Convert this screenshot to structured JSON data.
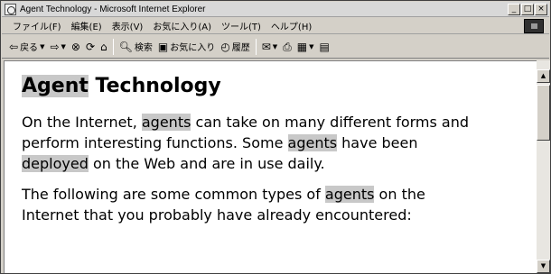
{
  "window": {
    "title": "Agent Technology - Microsoft Internet Explorer",
    "controls": [
      "_",
      "□",
      "×"
    ]
  },
  "menubar": {
    "items": [
      "ファイル(F)",
      "編集(E)",
      "表示(V)",
      "お気に入り(A)",
      "ツール(T)",
      "ヘルプ(H)"
    ]
  },
  "toolbar": {
    "back_label": "戻る",
    "search_label": "検索",
    "favorites_label": "お気に入り",
    "history_label": "履歴"
  },
  "page": {
    "heading_highlight": "Agent",
    "heading_rest": " Technology",
    "para1": {
      "line1_a": "On the Internet, ",
      "line1_hl": "agents",
      "line1_b": " can take on many different forms and",
      "line2_a": "perform interesting functions. Some ",
      "line2_hl": "agents",
      "line2_b": " have been",
      "line3_hl": "deployed",
      "line3_b": " on the Web and are in use daily."
    },
    "para2": {
      "line1_a": "The following are some common types of ",
      "line1_hl": "agents",
      "line1_b": " on the",
      "line2": "Internet that you probably have already encountered:"
    }
  },
  "icons": {
    "back": "back-arrow-icon",
    "forward": "forward-arrow-icon",
    "stop": "stop-icon",
    "refresh": "refresh-icon",
    "home": "home-icon",
    "search": "search-icon",
    "favorites": "favorites-icon",
    "history": "history-icon",
    "mail": "mail-icon",
    "print": "print-icon",
    "edit": "edit-icon",
    "discuss": "discuss-icon"
  }
}
